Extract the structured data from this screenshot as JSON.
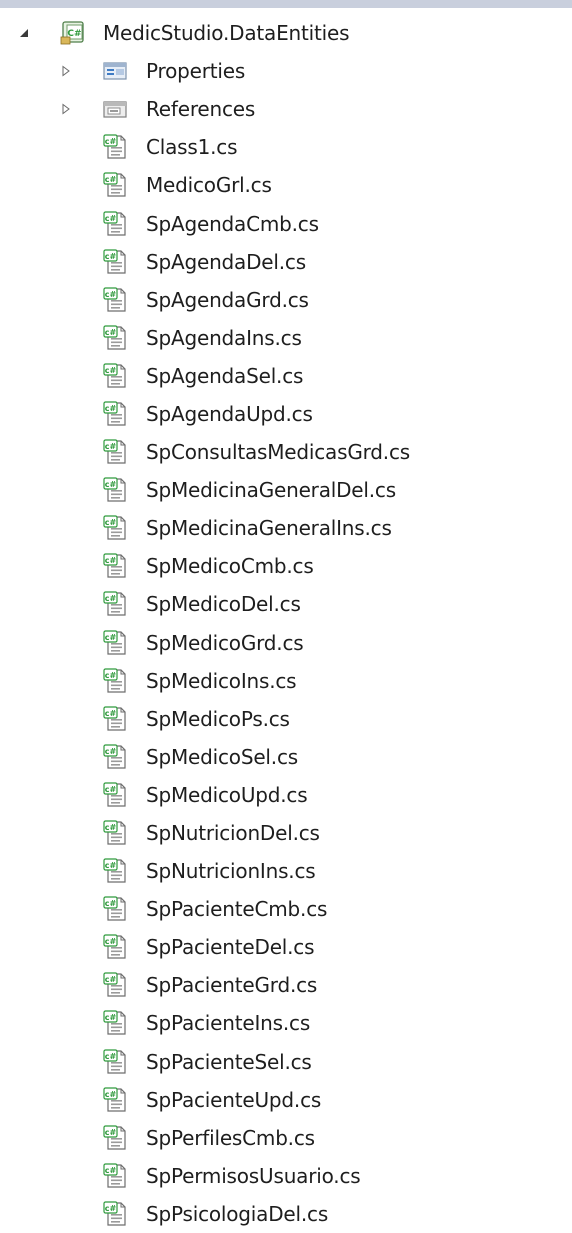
{
  "project": {
    "name": "MedicStudio.DataEntities",
    "expanded": true
  },
  "folders": [
    {
      "label": "Properties",
      "icon": "properties-folder-icon",
      "expanded": false
    },
    {
      "label": "References",
      "icon": "references-folder-icon",
      "expanded": false
    }
  ],
  "files": [
    "Class1.cs",
    "MedicoGrl.cs",
    "SpAgendaCmb.cs",
    "SpAgendaDel.cs",
    "SpAgendaGrd.cs",
    "SpAgendaIns.cs",
    "SpAgendaSel.cs",
    "SpAgendaUpd.cs",
    "SpConsultasMedicasGrd.cs",
    "SpMedicinaGeneralDel.cs",
    "SpMedicinaGeneralIns.cs",
    "SpMedicoCmb.cs",
    "SpMedicoDel.cs",
    "SpMedicoGrd.cs",
    "SpMedicoIns.cs",
    "SpMedicoPs.cs",
    "SpMedicoSel.cs",
    "SpMedicoUpd.cs",
    "SpNutricionDel.cs",
    "SpNutricionIns.cs",
    "SpPacienteCmb.cs",
    "SpPacienteDel.cs",
    "SpPacienteGrd.cs",
    "SpPacienteIns.cs",
    "SpPacienteSel.cs",
    "SpPacienteUpd.cs",
    "SpPerfilesCmb.cs",
    "SpPermisosUsuario.cs",
    "SpPsicologiaDel.cs"
  ],
  "colors": {
    "csharp_green": "#2f9a3c",
    "text": "#1e1e1e",
    "expander": "#555555"
  }
}
